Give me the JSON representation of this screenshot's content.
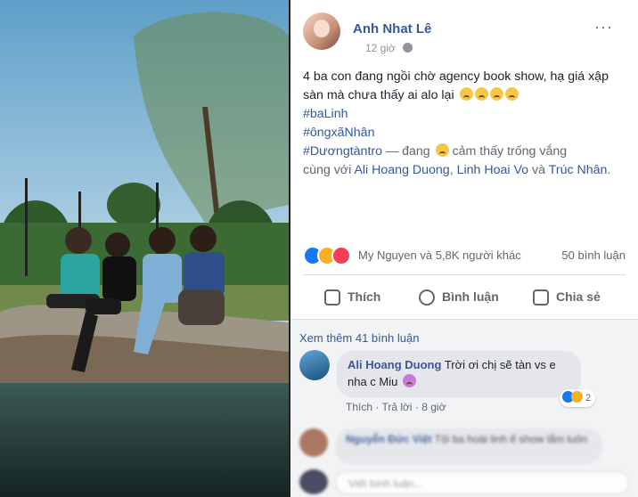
{
  "post": {
    "author": "Anh Nhat Lê",
    "time": "12 giờ",
    "more": "···",
    "text_line1": "4 ba con đang ngồi chờ agency book show, hạ giá xập sàn mà chưa thấy ai alo lại",
    "hashtags": [
      "#baLinh",
      "#ôngxãNhân",
      "#Dươngtàntro"
    ],
    "feeling_text": "— đang",
    "feeling": "cảm thấy trống vắng",
    "with_text": "cùng với",
    "tagged": [
      "Ali Hoang Duong",
      "Linh Hoai Vo",
      "Trúc Nhân"
    ],
    "and_text": "và"
  },
  "reactions": {
    "summary": "My Nguyen và 5,8K người khác",
    "comments": "50 bình luận"
  },
  "actions": {
    "like": "Thích",
    "comment": "Bình luận",
    "share": "Chia sẻ"
  },
  "comments": {
    "view_more": "Xem thêm 41 bình luận",
    "first": {
      "name": "Ali Hoang Duong",
      "text": "Trời ơi chị sẽ tàn vs e nha c Miu",
      "react_count": "2",
      "like": "Thích",
      "reply": "Trả lời",
      "time": "8 giờ"
    },
    "second": {
      "name": "Nguyễn Đức Việt",
      "text": "Tội ba hoài linh ế show lắm luôn"
    },
    "input_placeholder": "Viết bình luận..."
  },
  "colors": {
    "link": "#365899",
    "background": "#ffffff"
  }
}
